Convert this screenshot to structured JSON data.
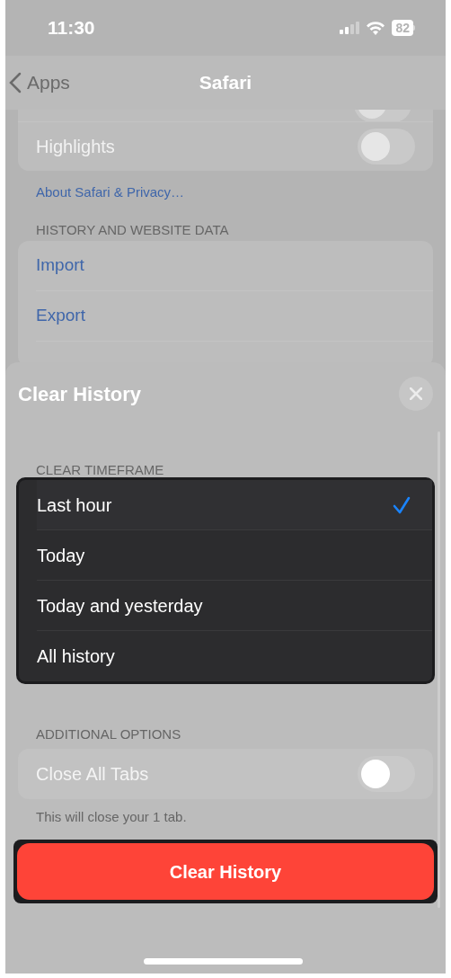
{
  "status_bar": {
    "time": "11:30",
    "battery": "82"
  },
  "nav": {
    "back": "Apps",
    "title": "Safari"
  },
  "settings": {
    "rows": [
      {
        "kind": "toggle",
        "on": false
      },
      {
        "kind": "toggle",
        "label": "Highlights",
        "on": false
      }
    ],
    "link": "About Safari & Privacy…",
    "section": "HISTORY AND WEBSITE DATA",
    "actions": [
      "Import",
      "Export"
    ]
  },
  "sheet": {
    "title": "Clear History",
    "timeframe_header": "CLEAR TIMEFRAME",
    "timeframes": [
      {
        "label": "Last hour",
        "selected": true
      },
      {
        "label": "Today",
        "selected": false
      },
      {
        "label": "Today and yesterday",
        "selected": false
      },
      {
        "label": "All history",
        "selected": false
      }
    ],
    "options_header": "ADDITIONAL OPTIONS",
    "options": [
      {
        "label": "Close All Tabs",
        "on": false
      }
    ],
    "footnote": "This will close your 1 tab.",
    "button": "Clear History"
  }
}
